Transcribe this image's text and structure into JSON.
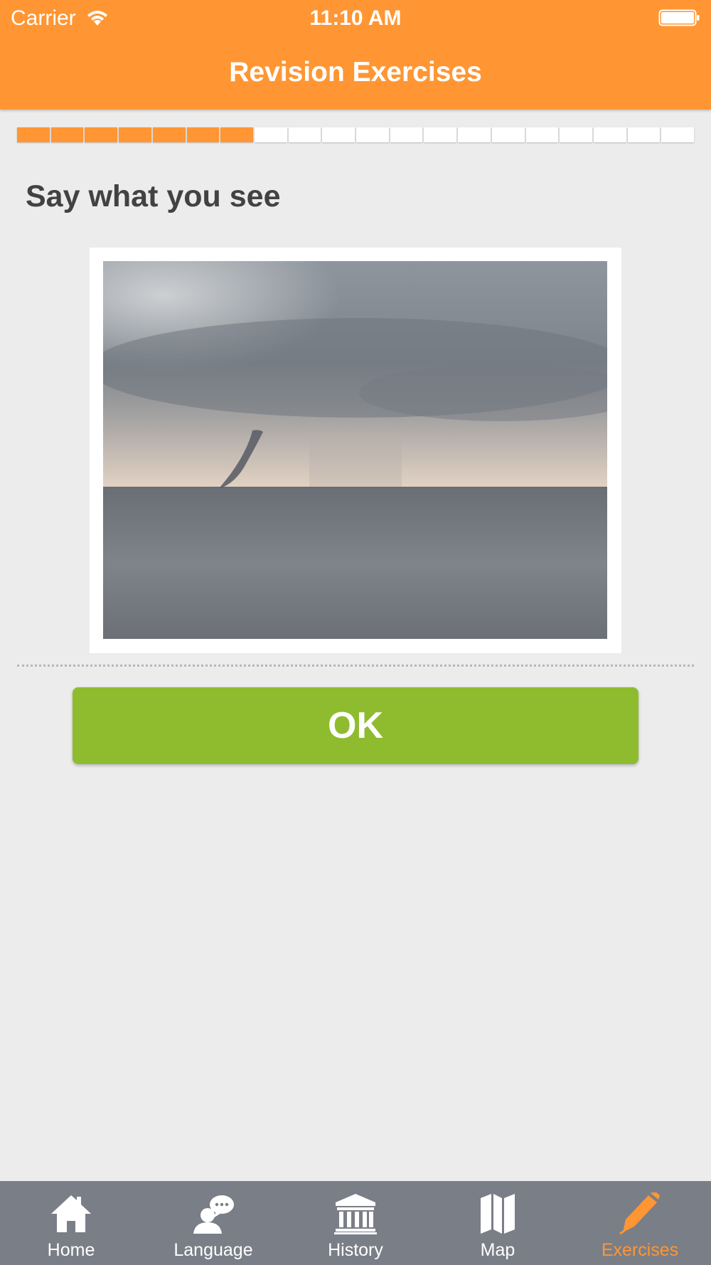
{
  "status_bar": {
    "carrier": "Carrier",
    "time": "11:10 AM"
  },
  "nav": {
    "title": "Revision Exercises"
  },
  "progress": {
    "completed": 7,
    "total": 20
  },
  "exercise": {
    "prompt": "Say what you see",
    "image": "waterspout-over-sea"
  },
  "actions": {
    "ok_label": "OK"
  },
  "tabs": [
    {
      "label": "Home",
      "icon": "home-icon"
    },
    {
      "label": "Language",
      "icon": "speech-person-icon"
    },
    {
      "label": "History",
      "icon": "museum-icon"
    },
    {
      "label": "Map",
      "icon": "map-icon"
    },
    {
      "label": "Exercises",
      "icon": "pencil-icon",
      "active": true
    }
  ],
  "colors": {
    "accent": "#ff9633",
    "ok_green": "#8fbc2f",
    "tabbar": "#7a7e87",
    "background": "#ececec"
  }
}
